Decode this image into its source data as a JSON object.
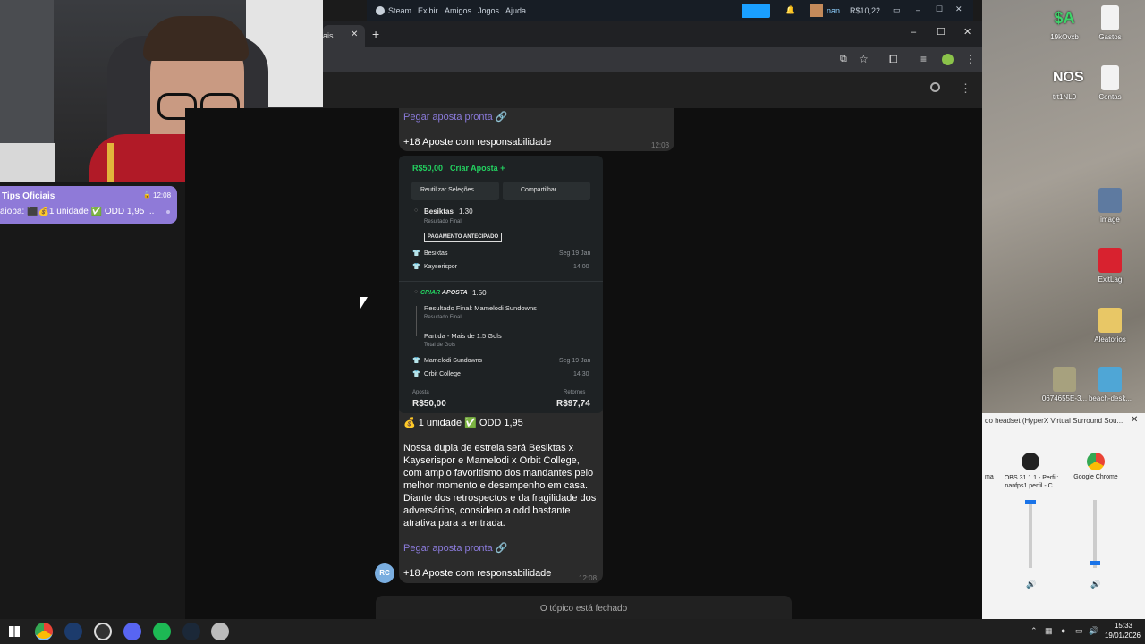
{
  "steam": {
    "brand": "Steam",
    "menu": [
      "Exibir",
      "Amigos",
      "Jogos",
      "Ajuda"
    ],
    "user": "nan",
    "balance": "R$10,22"
  },
  "chrome": {
    "tab_label": "ais",
    "new_tab": "+"
  },
  "left": {
    "chat_title": "Tips Oficiais",
    "chat_time": "12:08",
    "chat_preview": "aioba: ⬛💰1 unidade ✅ ODD 1,95 ..."
  },
  "messages": {
    "link_top": "Pegar aposta pronta 🔗",
    "resp_top": "+18 Aposte com responsabilidade",
    "time_top": "12:03",
    "odd_line": "💰 1 unidade ✅ ODD 1,95",
    "body": "Nossa dupla de estreia será Besiktas x Kayserispor e Mamelodi x Orbit College, com amplo favoritismo dos mandantes pelo melhor momento e desempenho em casa. Diante dos retrospectos e da fragilidade dos adversários, considero a odd bastante atrativa para a entrada.",
    "link_bottom": "Pegar aposta pronta 🔗",
    "resp_bottom": "+18 Aposte com responsabilidade",
    "time_bottom": "12:08",
    "avatar": "RC",
    "closed": "O tópico está fechado"
  },
  "slip": {
    "header_amount": "R$50,00",
    "header_create": "Criar Aposta +",
    "reuse": "Reutilizar Seleções",
    "share": "Compartilhar",
    "sel1": "Besiktas",
    "sel1_odd": "1.30",
    "sel1_market": "Resultado Final",
    "badge": "PAGAMENTO ANTECIPADO",
    "team1": "Besiktas",
    "team2": "Kayserispor",
    "date1": "Seg 19 Jan",
    "time1": "14:00",
    "criar": "CRIAR",
    "aposta": "APOSTA",
    "criar_odd": "1.50",
    "leg1": "Resultado Final: Mamelodi Sundowns",
    "leg1_sub": "Resultado Final",
    "leg2": "Partida - Mais de 1.5 Gols",
    "leg2_sub": "Total de Gols",
    "team3": "Mamelodi Sundowns",
    "team4": "Orbit College",
    "date2": "Seg 19 Jan",
    "time2": "14:30",
    "stake_label": "Aposta",
    "stake": "R$50,00",
    "return_label": "Retornos",
    "return": "R$97,74"
  },
  "desktop": {
    "icons": [
      "19kOvxb",
      "Gastos",
      "trt1NL0",
      "Contas",
      "image",
      "ExitLag",
      "Aleatorios",
      "0674655E-3...",
      "beach-desk..."
    ],
    "sa": "$A",
    "nos": "NOS"
  },
  "mixer": {
    "title": "do headset (HyperX Virtual Surround Sou...",
    "app0": "ma",
    "app1": "OBS 31.1.1 - Perfil: nanfps1 perfil - C...",
    "app2": "Google Chrome"
  },
  "clock": {
    "time": "15:33",
    "date": "19/01/2026"
  }
}
